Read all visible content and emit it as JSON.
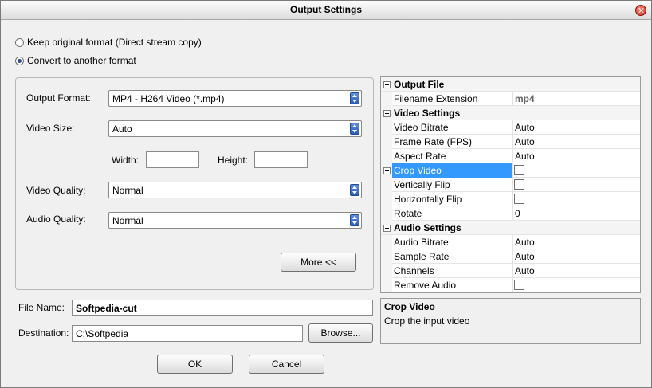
{
  "window": {
    "title": "Output Settings"
  },
  "mode": {
    "options": [
      {
        "label": "Keep original format (Direct stream copy)",
        "checked": false
      },
      {
        "label": "Convert to another format",
        "checked": true
      }
    ]
  },
  "format": {
    "output_format_label": "Output Format:",
    "output_format_value": "MP4 - H264 Video (*.mp4)",
    "video_size_label": "Video Size:",
    "video_size_value": "Auto",
    "width_label": "Width:",
    "width_value": "",
    "height_label": "Height:",
    "height_value": "",
    "video_quality_label": "Video Quality:",
    "video_quality_value": "Normal",
    "audio_quality_label": "Audio Quality:",
    "audio_quality_value": "Normal",
    "more_button": "More <<"
  },
  "file": {
    "file_name_label": "File Name:",
    "file_name_value": "Softpedia-cut",
    "destination_label": "Destination:",
    "destination_value": "C:\\Softpedia",
    "browse_button": "Browse..."
  },
  "properties": {
    "output_file": {
      "category": "Output File",
      "filename_extension_name": "Filename Extension",
      "filename_extension_value": "mp4"
    },
    "video_settings": {
      "category": "Video Settings",
      "video_bitrate_name": "Video Bitrate",
      "video_bitrate_value": "Auto",
      "frame_rate_name": "Frame Rate (FPS)",
      "frame_rate_value": "Auto",
      "aspect_rate_name": "Aspect Rate",
      "aspect_rate_value": "Auto",
      "crop_video_name": "Crop Video",
      "crop_video_checked": false,
      "vertically_flip_name": "Vertically Flip",
      "vertically_flip_checked": false,
      "horizontally_flip_name": "Horizontally Flip",
      "horizontally_flip_checked": false,
      "rotate_name": "Rotate",
      "rotate_value": "0"
    },
    "audio_settings": {
      "category": "Audio Settings",
      "audio_bitrate_name": "Audio Bitrate",
      "audio_bitrate_value": "Auto",
      "sample_rate_name": "Sample Rate",
      "sample_rate_value": "Auto",
      "channels_name": "Channels",
      "channels_value": "Auto",
      "remove_audio_name": "Remove Audio",
      "remove_audio_checked": false
    }
  },
  "description": {
    "title": "Crop Video",
    "text": "Crop the input video"
  },
  "buttons": {
    "ok": "OK",
    "cancel": "Cancel"
  },
  "colors": {
    "selection": "#3399ff",
    "spin_accent": "#2a5cb8",
    "close_button": "#c8281a"
  }
}
